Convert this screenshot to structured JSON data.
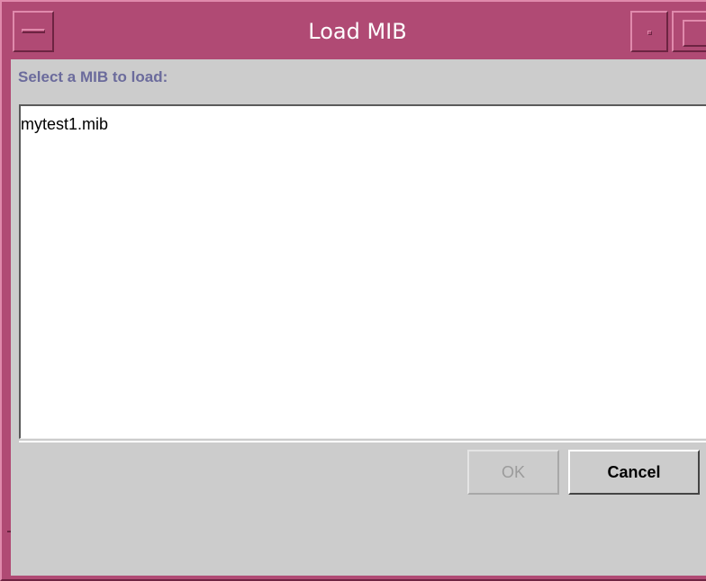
{
  "window": {
    "title": "Load MIB"
  },
  "dialog": {
    "prompt": "Select a MIB to load:",
    "files": [
      "mytest1.mib"
    ],
    "ok_label": "OK",
    "ok_enabled": false,
    "cancel_label": "Cancel"
  },
  "theme": {
    "frame_color": "#b04a74",
    "panel_color": "#cccccc",
    "prompt_color": "#6b6b9c"
  }
}
